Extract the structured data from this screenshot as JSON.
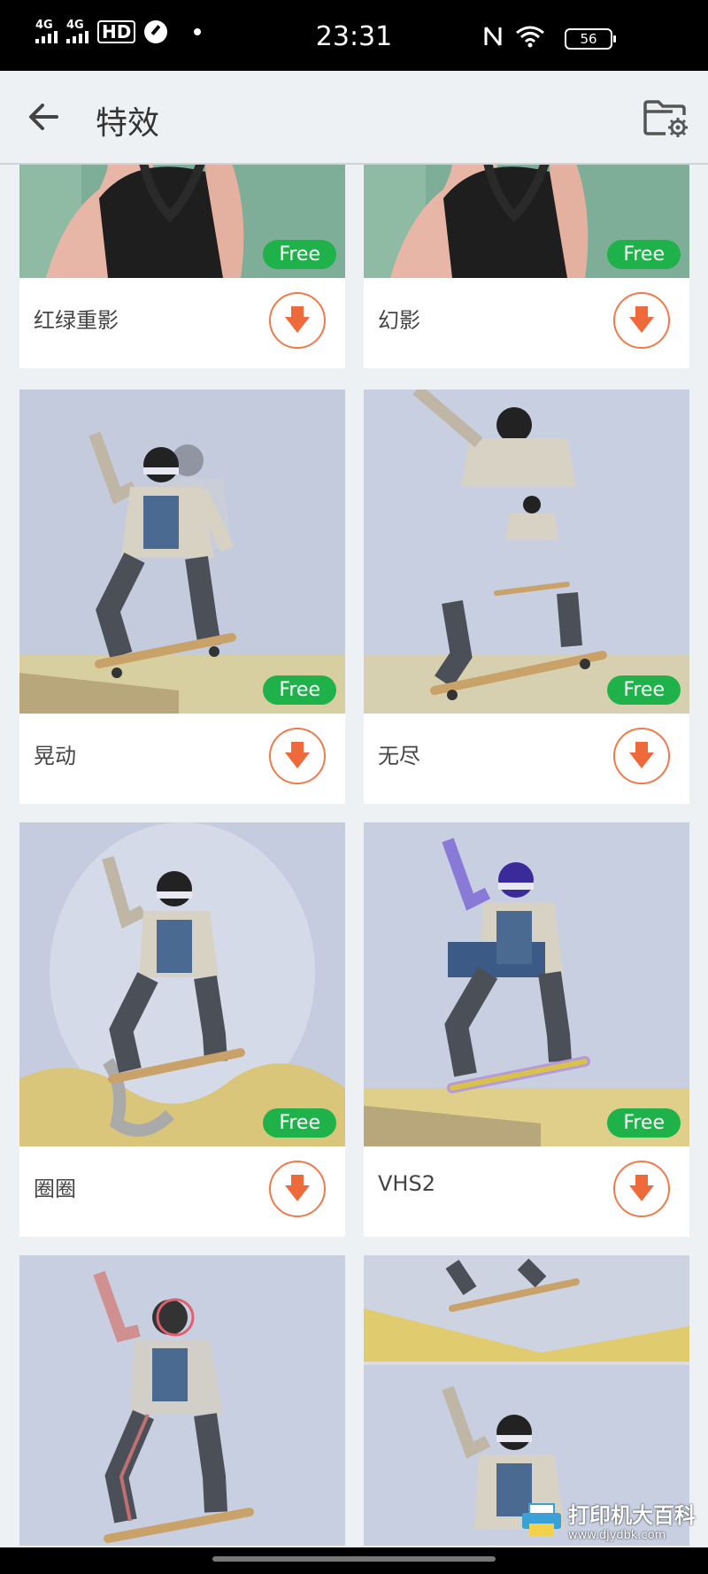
{
  "status_bar": {
    "network1": "4G",
    "network2": "4G",
    "hd": "HD",
    "time": "23:31",
    "battery": "56"
  },
  "app_bar": {
    "title": "特效"
  },
  "cards": [
    {
      "label": "红绿重影",
      "badge": "Free"
    },
    {
      "label": "幻影",
      "badge": "Free"
    },
    {
      "label": "晃动",
      "badge": "Free"
    },
    {
      "label": "无尽",
      "badge": "Free"
    },
    {
      "label": "圈圈",
      "badge": "Free"
    },
    {
      "label": "VHS2",
      "badge": "Free"
    }
  ],
  "watermark": {
    "title": "打印机大百科",
    "site": "www.djydbk.com"
  }
}
